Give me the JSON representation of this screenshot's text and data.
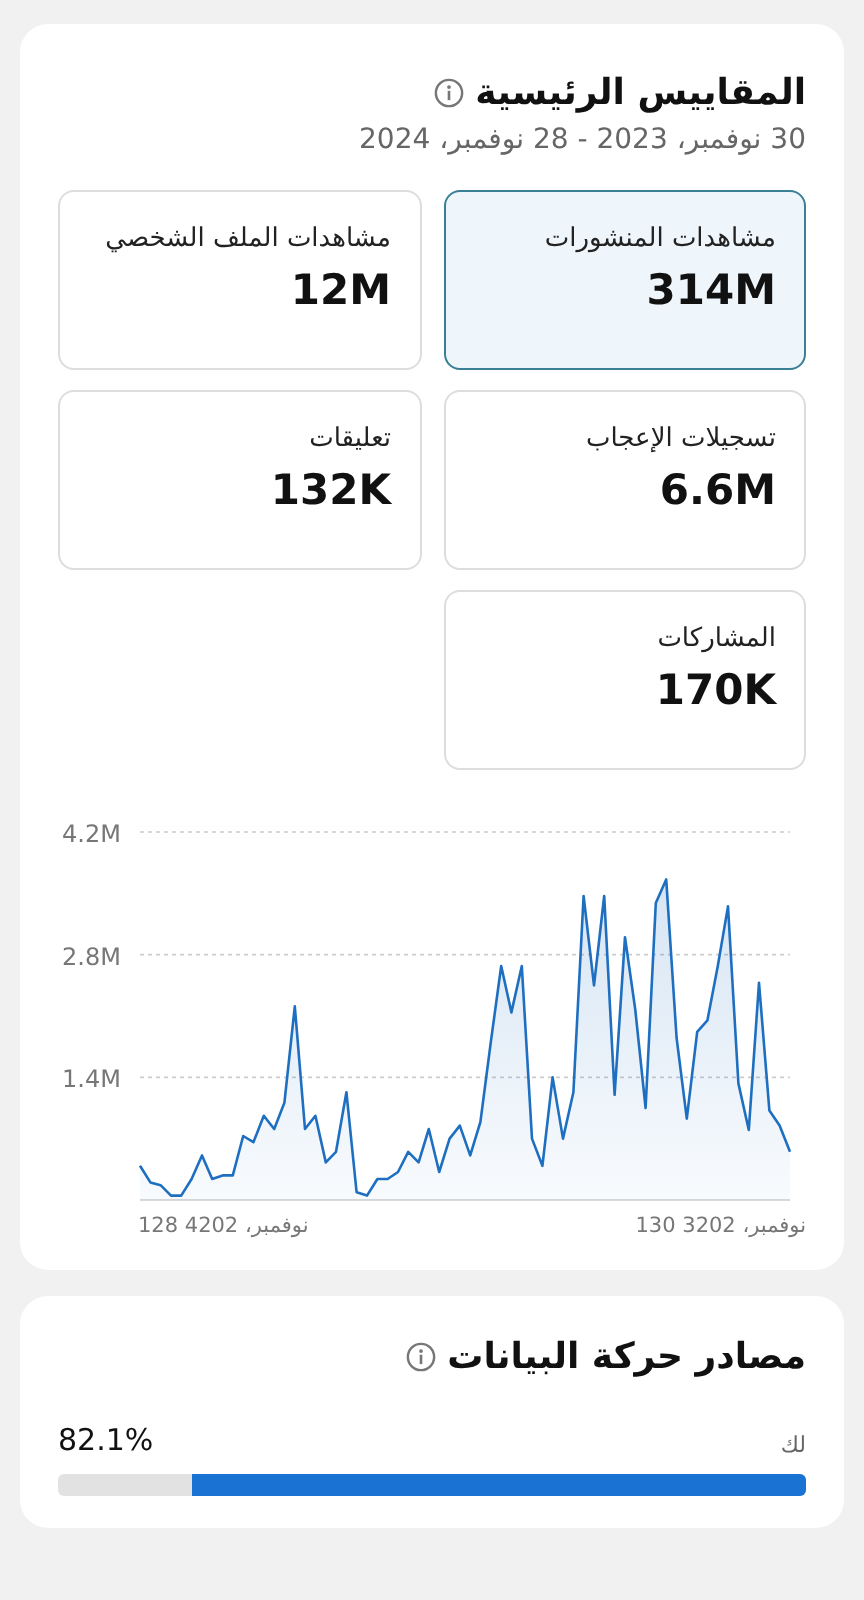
{
  "metrics": {
    "title": "المقاييس الرئيسية",
    "date_range": "30 نوفمبر، 2023 - 28 نوفمبر، 2024",
    "cards": [
      {
        "label": "مشاهدات المنشورات",
        "value": "314M",
        "selected": true
      },
      {
        "label": "مشاهدات الملف الشخصي",
        "value": "12M",
        "selected": false
      },
      {
        "label": "تسجيلات الإعجاب",
        "value": "6.6M",
        "selected": false
      },
      {
        "label": "تعليقات",
        "value": "132K",
        "selected": false
      },
      {
        "label": "المشاركات",
        "value": "170K",
        "selected": false
      }
    ],
    "chart_data": {
      "type": "area",
      "ylim": [
        0,
        4.2
      ],
      "yticks": [
        {
          "value": 1.4,
          "label": "1.4M"
        },
        {
          "value": 2.8,
          "label": "2.8M"
        },
        {
          "value": 4.2,
          "label": "4.2M"
        }
      ],
      "series": [
        {
          "color": "#1f6fc0",
          "values": [
            0.39,
            0.2,
            0.17,
            0.05,
            0.05,
            0.24,
            0.51,
            0.24,
            0.28,
            0.28,
            0.73,
            0.66,
            0.96,
            0.81,
            1.11,
            2.21,
            0.81,
            0.96,
            0.43,
            0.55,
            1.23,
            0.09,
            0.05,
            0.24,
            0.24,
            0.32,
            0.55,
            0.43,
            0.81,
            0.32,
            0.7,
            0.85,
            0.51,
            0.89,
            1.8,
            2.67,
            2.14,
            2.67,
            0.7,
            0.39,
            1.4,
            0.7,
            1.23,
            3.47,
            2.45,
            3.47,
            1.2,
            3.0,
            2.18,
            1.05,
            3.39,
            3.66,
            1.85,
            0.93,
            1.92,
            2.05,
            2.67,
            3.35,
            1.33,
            0.8,
            2.48,
            1.02,
            0.85,
            0.55
          ]
        }
      ]
    },
    "chart_x_labels": [
      "نوفمبر، 3202 130",
      "نوفمبر، 4202 128"
    ]
  },
  "traffic": {
    "title": "مصادر حركة البيانات",
    "sources": [
      {
        "label": "لك",
        "share": "82.1%",
        "level": 0.821
      }
    ]
  }
}
